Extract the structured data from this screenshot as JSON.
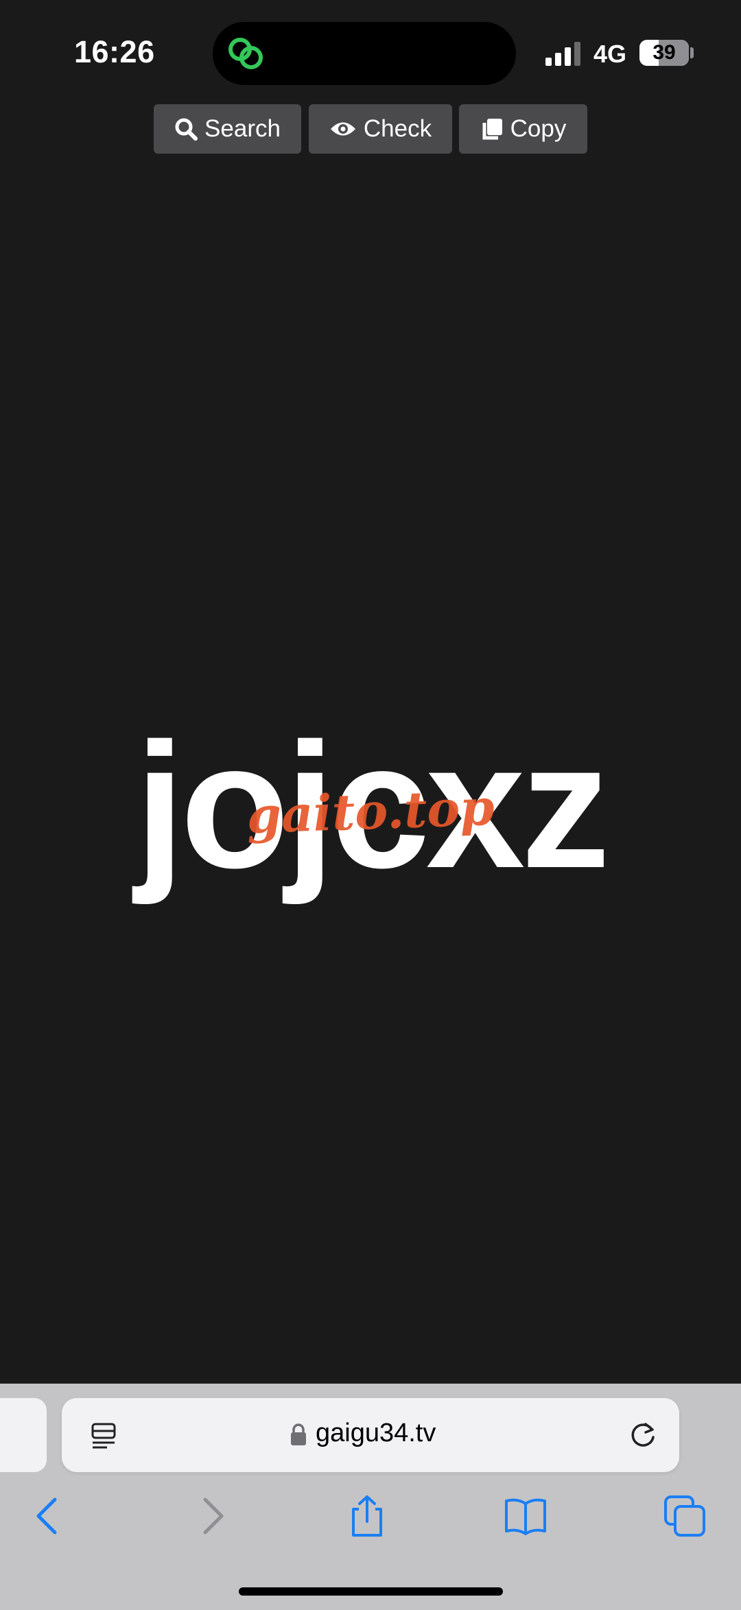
{
  "status_bar": {
    "time": "16:26",
    "network": "4G",
    "battery_level": "39",
    "battery_fraction": 0.39,
    "island_icon": "link-rings-icon",
    "island_icon_color": "#34c759"
  },
  "toolbar": {
    "search_label": "Search",
    "check_label": "Check",
    "copy_label": "Copy",
    "search_icon": "magnifier-icon",
    "check_icon": "eye-icon",
    "copy_icon": "copy-icon"
  },
  "content": {
    "code": "jojcxz",
    "watermark": "gaito.top",
    "watermark_color": "#e8572a"
  },
  "safari": {
    "url": "gaigu34.tv",
    "accent_color": "#1a7ef5",
    "icons": [
      "reader-icon",
      "lock-icon",
      "reload-icon",
      "back-icon",
      "forward-icon",
      "share-icon",
      "bookmarks-icon",
      "tabs-icon"
    ]
  }
}
